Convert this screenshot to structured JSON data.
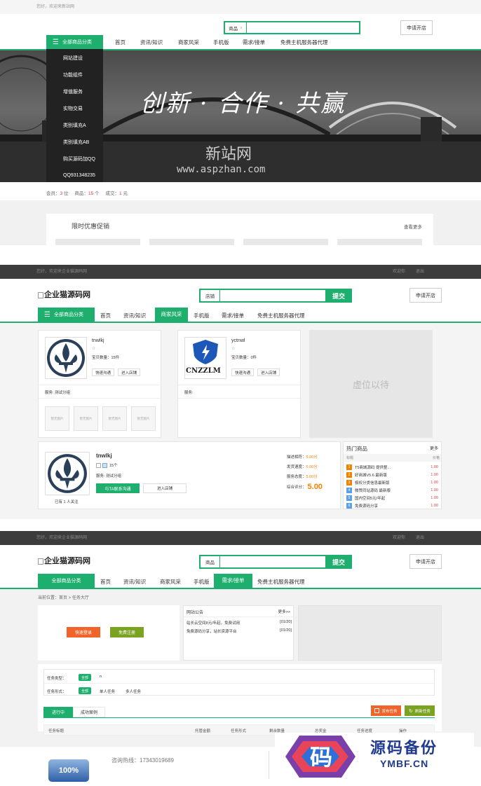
{
  "s1": {
    "topbar": "您好，欢迎来新站网",
    "search_select": "商品",
    "apply_btn": "申请开店",
    "category_btn": "全部商品分类",
    "nav": [
      "首页",
      "资讯/知识",
      "商家风采",
      "手机版",
      "需求/接单",
      "免费主机服务器代理"
    ],
    "menu": [
      "网站建设",
      "功能组件",
      "增值服务",
      "实物交易",
      "类别填充A",
      "类别填充AB",
      "购买源码加QQ",
      "QQ931348235"
    ],
    "banner_slogan": "创新 · 合作 · 共赢",
    "watermark_cn": "新站网",
    "watermark_url": "www.aspzhan.com",
    "stats": {
      "member_label": "会员：",
      "member_val": "3",
      "member_unit": "位",
      "goods_label": "商品：",
      "goods_val": "15",
      "goods_unit": "个",
      "deal_label": "成交：",
      "deal_val": "1",
      "deal_unit": "元"
    },
    "promo_title": "限时优惠促销",
    "promo_more": "查看更多"
  },
  "s2": {
    "topbar_left": "您好，欢迎来企业猫源码网",
    "topbar_right": "欢迎你",
    "topbar_logout": "退出",
    "logo": "企业猫源码网",
    "search_select": "店铺",
    "search_btn": "提交",
    "apply_btn": "申请开店",
    "category_btn": "全部商品分类",
    "nav": [
      "首页",
      "资讯/知识",
      "商家风采",
      "手机版",
      "需求/接单",
      "免费主机服务器代理"
    ],
    "shop1": {
      "name": "tnwlkj",
      "count": "宝贝数量：15件",
      "chat": "快速沟通",
      "enter": "进入店铺",
      "service": "服务: 测试分组",
      "ph": [
        "暂无图片",
        "暂无图片",
        "暂无图片",
        "暂无图片"
      ]
    },
    "shop2": {
      "name": "yctnwl",
      "count": "宝贝数量：0件",
      "chat": "快速沟通",
      "enter": "进入店铺",
      "service": "服务:",
      "logo_text": "CNZZLM"
    },
    "vacancy": "虚位以待",
    "detail": {
      "name": "tnwlkj",
      "count": "15个",
      "service": "服务: 测试分组",
      "chat": "与TA联系沟通",
      "enter": "进入店铺",
      "followers": "已有 1 人关注",
      "ratings": [
        {
          "label": "描述相符：",
          "val": "5.00分"
        },
        {
          "label": "发货速度：",
          "val": "5.00分"
        },
        {
          "label": "服务态度：",
          "val": "5.00分"
        }
      ],
      "total_label": "综合评分：",
      "total_val": "5.00"
    },
    "hot": {
      "title": "热门商品",
      "more": "更多",
      "col1": "标题",
      "col2": "价格",
      "items": [
        {
          "n": "1",
          "name": "T5商城源码 提供整...",
          "price": "1.00"
        },
        {
          "n": "2",
          "name": "好商城V5.6 最新版",
          "price": "1.00"
        },
        {
          "n": "3",
          "name": "极权分类信息最新版",
          "price": "1.00"
        },
        {
          "n": "4",
          "name": "微赞同站源码 最新版",
          "price": "1.00"
        },
        {
          "n": "5",
          "name": "国内空间5元/年起",
          "price": "1.00"
        },
        {
          "n": "6",
          "name": "免费源码分享",
          "price": "1.00"
        }
      ]
    }
  },
  "s3": {
    "topbar_left": "您好，欢迎来企业猫源码网",
    "topbar_right": "欢迎你",
    "topbar_logout": "退出",
    "logo": "企业猫源码网",
    "search_select": "商品",
    "search_btn": "提交",
    "apply_btn": "申请开店",
    "category_btn": "全部商品分类",
    "nav": [
      "首页",
      "资讯/知识",
      "商家风采",
      "手机版",
      "需求/接单",
      "免费主机服务器代理"
    ],
    "breadcrumb": "当前位置：首页 > 任务大厅",
    "quick_login": "快速登录",
    "free_register": "免费注册",
    "notice": {
      "title": "网站公告",
      "more": "更多>>",
      "items": [
        {
          "text": "站长云空间8元/年起，免费试用",
          "date": "[01/20]"
        },
        {
          "text": "免费源码分享，站长资源平台",
          "date": "[01/20]"
        }
      ]
    },
    "task_type_label": "任务类型：",
    "task_type_all": "全部",
    "task_type_n": "n",
    "task_form_label": "任务形式：",
    "task_form_all": "全部",
    "task_form_single": "单人任务",
    "task_form_multi": "多人任务",
    "tab_ongoing": "进行中",
    "tab_success": "成功案例",
    "publish_btn": "发布任务",
    "refresh_btn": "刷新任务",
    "table_headers": [
      "任务标题",
      "托管金额",
      "任务形式",
      "剩余数量",
      "总奖金",
      "任务进度",
      "操作"
    ],
    "hotline_label": "咨询热线：",
    "hotline": "17343019689",
    "badge": "100%",
    "wm_char": "码",
    "wm_title": "源码备份",
    "wm_url": "YMBF.CN"
  },
  "colors": {
    "accent": "#1eae6e",
    "price": "#e4393c",
    "login": "#f0642b",
    "register": "#79a321"
  }
}
